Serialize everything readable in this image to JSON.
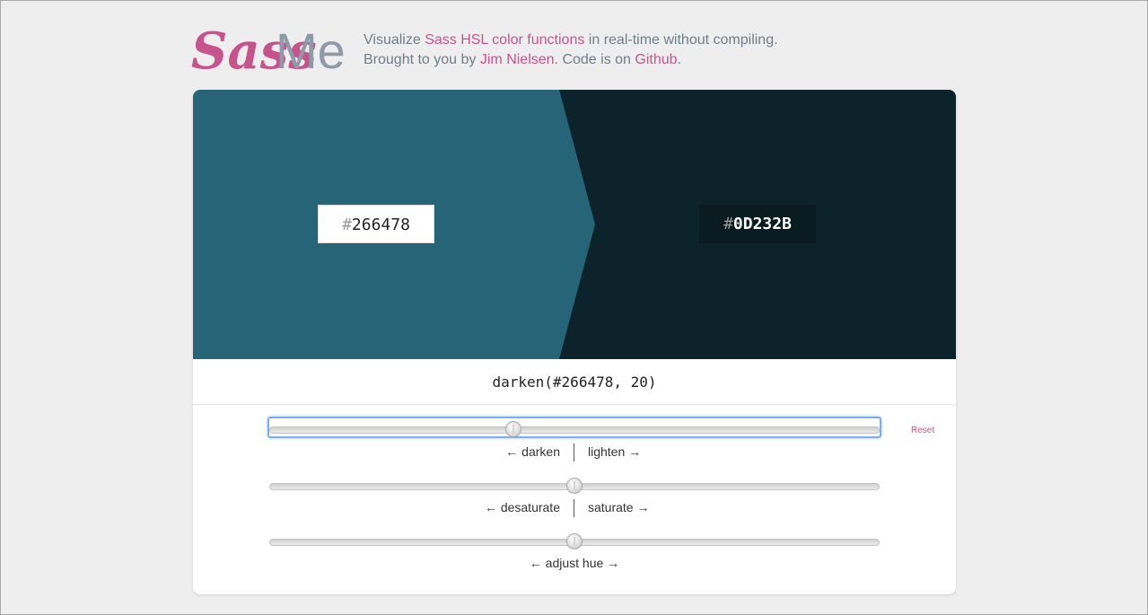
{
  "header": {
    "logo_text_1": "Sass",
    "logo_text_2": "Me",
    "line1_pre": "Visualize ",
    "line1_link": "Sass HSL color functions",
    "line1_post": " in real-time without compiling.",
    "line2_pre": "Brought to you by ",
    "line2_link_author": "Jim Nielsen",
    "line2_mid": ". Code is on ",
    "line2_link_code": "Github",
    "line2_post": "."
  },
  "colors": {
    "input_hex": "266478",
    "output_hex": "0D232B",
    "input_color": "#266478",
    "output_color": "#0d232b",
    "accent": "#c6538c"
  },
  "hash_symbol": "#",
  "function_text": "darken(#266478, 20)",
  "sliders": {
    "lightness": {
      "left_label": "← darken",
      "right_label": "lighten →",
      "value": -20,
      "range": [
        -100,
        100
      ]
    },
    "saturation": {
      "left_label": "← desaturate",
      "right_label": "saturate →",
      "value": 0,
      "range": [
        -100,
        100
      ]
    },
    "hue": {
      "label": "← adjust hue →",
      "value": 0,
      "range": [
        -180,
        180
      ]
    }
  },
  "reset_label": "Reset"
}
